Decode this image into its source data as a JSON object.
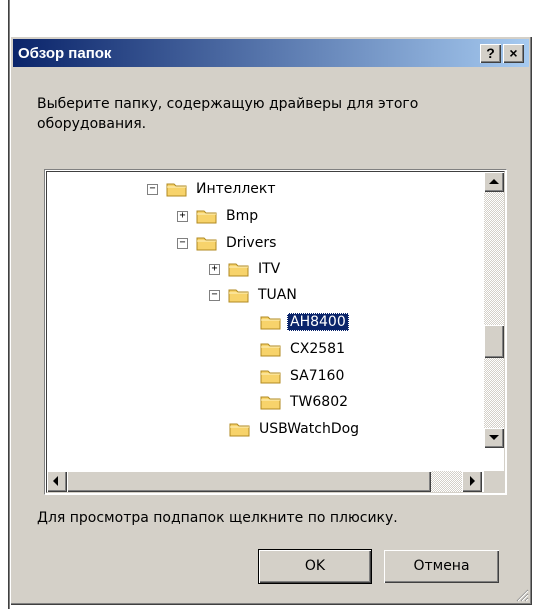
{
  "dialog": {
    "title": "Обзор папок",
    "help_label": "?",
    "close_label": "×",
    "instruction": "Выберите папку, содержащую драйверы для этого оборудования.",
    "hint": "Для просмотра подпапок щелкните по плюсику.",
    "ok_label": "OK",
    "cancel_label": "Отмена"
  },
  "tree": {
    "items": [
      {
        "label": "Интеллект",
        "toggle": "−",
        "selected": false
      },
      {
        "label": "Bmp",
        "toggle": "+",
        "selected": false
      },
      {
        "label": "Drivers",
        "toggle": "−",
        "selected": false
      },
      {
        "label": "ITV",
        "toggle": "+",
        "selected": false
      },
      {
        "label": "TUAN",
        "toggle": "−",
        "selected": false
      },
      {
        "label": "AH8400",
        "toggle": "",
        "selected": true
      },
      {
        "label": "CX2581",
        "toggle": "",
        "selected": false
      },
      {
        "label": "SA7160",
        "toggle": "",
        "selected": false
      },
      {
        "label": "TW6802",
        "toggle": "",
        "selected": false
      },
      {
        "label": "USBWatchDog",
        "toggle": "",
        "selected": false
      }
    ]
  },
  "colors": {
    "face": "#d4d0c8",
    "title_start": "#0a246a",
    "title_end": "#a6caf0",
    "selection": "#0a246a",
    "folder": "#f7d36b"
  }
}
